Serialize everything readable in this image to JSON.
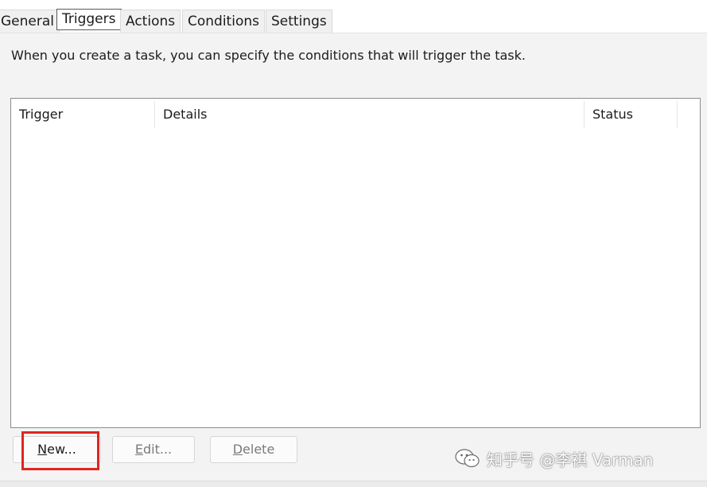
{
  "tabs": [
    {
      "label": "General",
      "active": false
    },
    {
      "label": "Triggers",
      "active": true
    },
    {
      "label": "Actions",
      "active": false
    },
    {
      "label": "Conditions",
      "active": false
    },
    {
      "label": "Settings",
      "active": false
    }
  ],
  "description": "When you create a task, you can specify the conditions that will trigger the task.",
  "list": {
    "columns": [
      "Trigger",
      "Details",
      "Status"
    ],
    "rows": []
  },
  "buttons": {
    "new": {
      "mnemonic": "N",
      "rest": "ew...",
      "enabled": true
    },
    "edit": {
      "mnemonic": "E",
      "rest": "dit...",
      "enabled": false
    },
    "delete": {
      "mnemonic": "D",
      "rest": "elete",
      "enabled": false
    }
  },
  "annotation_color": "#e0251f",
  "watermark": {
    "icon": "wechat-logo",
    "text": "知乎号 @李祺 Varman"
  }
}
